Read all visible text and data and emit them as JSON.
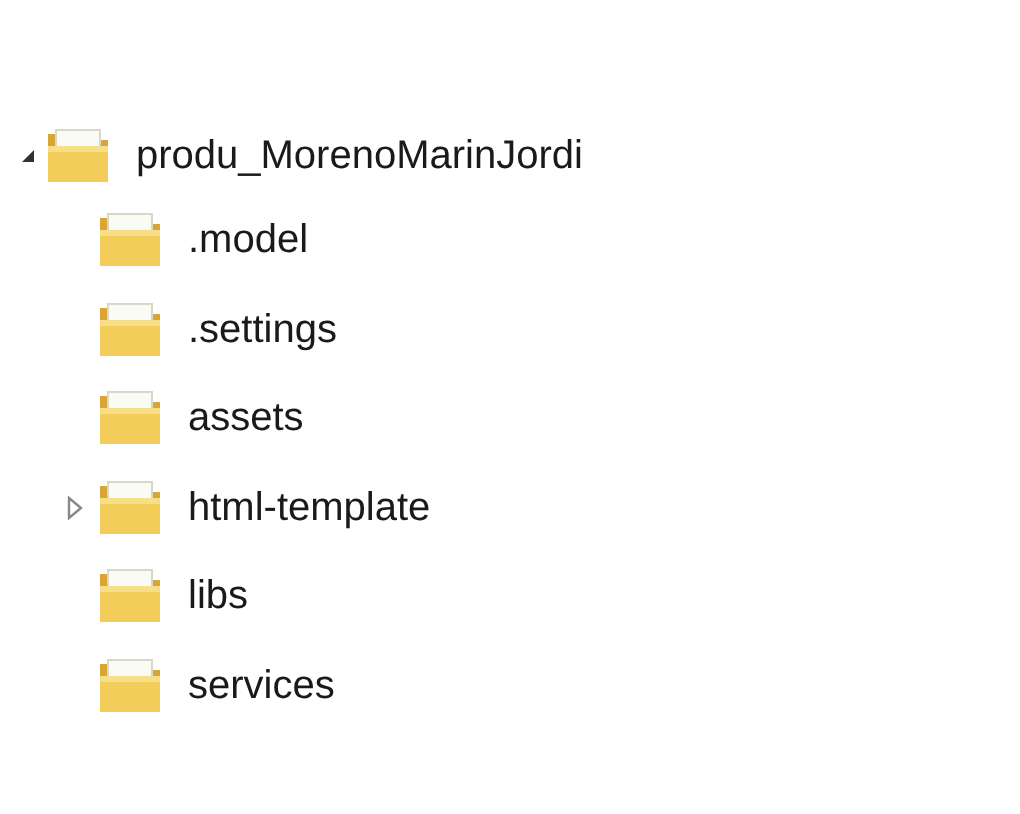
{
  "tree": {
    "name": "produ_MorenoMarinJordi",
    "expanded": true,
    "children": [
      {
        "name": ".model",
        "expandable": false
      },
      {
        "name": ".settings",
        "expandable": false
      },
      {
        "name": "assets",
        "expandable": false
      },
      {
        "name": "html-template",
        "expandable": true,
        "expanded": false
      },
      {
        "name": "libs",
        "expandable": false
      },
      {
        "name": "services",
        "expandable": false
      }
    ]
  }
}
